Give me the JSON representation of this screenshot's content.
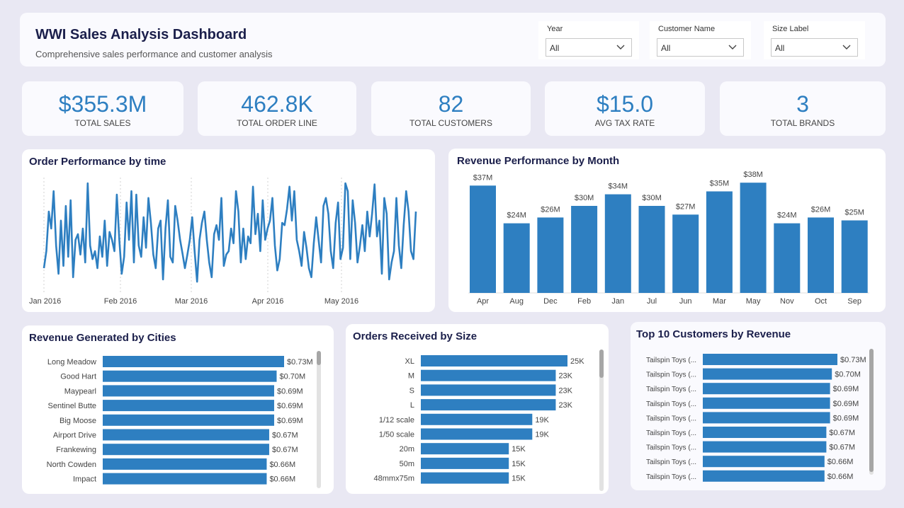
{
  "header": {
    "title": "WWI Sales Analysis Dashboard",
    "subtitle": "Comprehensive sales performance and customer analysis"
  },
  "filters": [
    {
      "label": "Year",
      "value": "All"
    },
    {
      "label": "Customer Name",
      "value": "All"
    },
    {
      "label": "Size Label",
      "value": "All"
    }
  ],
  "kpis": [
    {
      "value": "$355.3M",
      "label": "TOTAL SALES"
    },
    {
      "value": "462.8K",
      "label": "TOTAL ORDER LINE"
    },
    {
      "value": "82",
      "label": "TOTAL CUSTOMERS"
    },
    {
      "value": "$15.0",
      "label": "AVG TAX RATE"
    },
    {
      "value": "3",
      "label": "TOTAL BRANDS"
    }
  ],
  "colors": {
    "accent": "#2E7FC1",
    "title": "#1B1F4B",
    "background": "#E9E8F3"
  },
  "chart_data": [
    {
      "type": "line",
      "title": "Order Performance by time",
      "x_ticks": [
        "Jan 2016",
        "Feb 2016",
        "Mar 2016",
        "Apr 2016",
        "May 2016"
      ],
      "ylim": [
        0,
        100
      ],
      "grid": false,
      "values": [
        20,
        35,
        70,
        55,
        88,
        40,
        15,
        62,
        22,
        75,
        30,
        80,
        12,
        45,
        50,
        32,
        55,
        25,
        95,
        40,
        28,
        35,
        20,
        48,
        30,
        62,
        22,
        52,
        45,
        35,
        85,
        45,
        15,
        30,
        78,
        45,
        88,
        25,
        85,
        40,
        30,
        65,
        38,
        82,
        60,
        32,
        20,
        55,
        62,
        10,
        55,
        80,
        30,
        25,
        75,
        62,
        45,
        33,
        20,
        32,
        45,
        65,
        35,
        8,
        45,
        60,
        70,
        45,
        25,
        12,
        50,
        58,
        45,
        82,
        22,
        32,
        35,
        55,
        42,
        88,
        70,
        25,
        55,
        28,
        48,
        42,
        92,
        50,
        68,
        35,
        80,
        45,
        55,
        62,
        82,
        40,
        18,
        28,
        60,
        58,
        72,
        92,
        62,
        88,
        45,
        35,
        22,
        52,
        38,
        20,
        12,
        42,
        65,
        45,
        25,
        75,
        82,
        68,
        35,
        20,
        60,
        78,
        28,
        38,
        95,
        88,
        28,
        80,
        60,
        25,
        40,
        58,
        35,
        70,
        48,
        68,
        94,
        48,
        62,
        15,
        82,
        68,
        10,
        25,
        35,
        82,
        40,
        20,
        58,
        88,
        70,
        35,
        28,
        70
      ],
      "value_labels": false
    },
    {
      "type": "bar",
      "title": "Revenue Performance by Month",
      "categories": [
        "Apr",
        "Aug",
        "Dec",
        "Feb",
        "Jan",
        "Jul",
        "Jun",
        "Mar",
        "May",
        "Nov",
        "Oct",
        "Sep"
      ],
      "values": [
        37,
        24,
        26,
        30,
        34,
        30,
        27,
        35,
        38,
        24,
        26,
        25
      ],
      "labels": [
        "$37M",
        "$24M",
        "$26M",
        "$30M",
        "$34M",
        "$30M",
        "$27M",
        "$35M",
        "$38M",
        "$24M",
        "$26M",
        "$25M"
      ],
      "ylim": [
        0,
        40
      ]
    },
    {
      "type": "bar",
      "orientation": "horizontal",
      "title": "Revenue Generated by Cities",
      "categories": [
        "Long Meadow",
        "Good Hart",
        "Maypearl",
        "Sentinel Butte",
        "Big Moose",
        "Airport Drive",
        "Frankewing",
        "North Cowden",
        "Impact"
      ],
      "values": [
        0.73,
        0.7,
        0.69,
        0.69,
        0.69,
        0.67,
        0.67,
        0.66,
        0.66
      ],
      "labels": [
        "$0.73M",
        "$0.70M",
        "$0.69M",
        "$0.69M",
        "$0.69M",
        "$0.67M",
        "$0.67M",
        "$0.66M",
        "$0.66M"
      ]
    },
    {
      "type": "bar",
      "orientation": "horizontal",
      "title": "Orders Received by Size",
      "categories": [
        "XL",
        "M",
        "S",
        "L",
        "1/12 scale",
        "1/50 scale",
        "20m",
        "50m",
        "48mmx75m"
      ],
      "values": [
        25,
        23,
        23,
        23,
        19,
        19,
        15,
        15,
        15
      ],
      "labels": [
        "25K",
        "23K",
        "23K",
        "23K",
        "19K",
        "19K",
        "15K",
        "15K",
        "15K"
      ]
    },
    {
      "type": "bar",
      "orientation": "horizontal",
      "title": "Top 10 Customers by Revenue",
      "categories": [
        "Tailspin Toys (...",
        "Tailspin Toys (...",
        "Tailspin Toys (...",
        "Tailspin Toys (...",
        "Tailspin Toys (...",
        "Tailspin Toys (...",
        "Tailspin Toys (...",
        "Tailspin Toys (...",
        "Tailspin Toys (..."
      ],
      "values": [
        0.73,
        0.7,
        0.69,
        0.69,
        0.69,
        0.67,
        0.67,
        0.66,
        0.66
      ],
      "labels": [
        "$0.73M",
        "$0.70M",
        "$0.69M",
        "$0.69M",
        "$0.69M",
        "$0.67M",
        "$0.67M",
        "$0.66M",
        "$0.66M"
      ]
    }
  ]
}
